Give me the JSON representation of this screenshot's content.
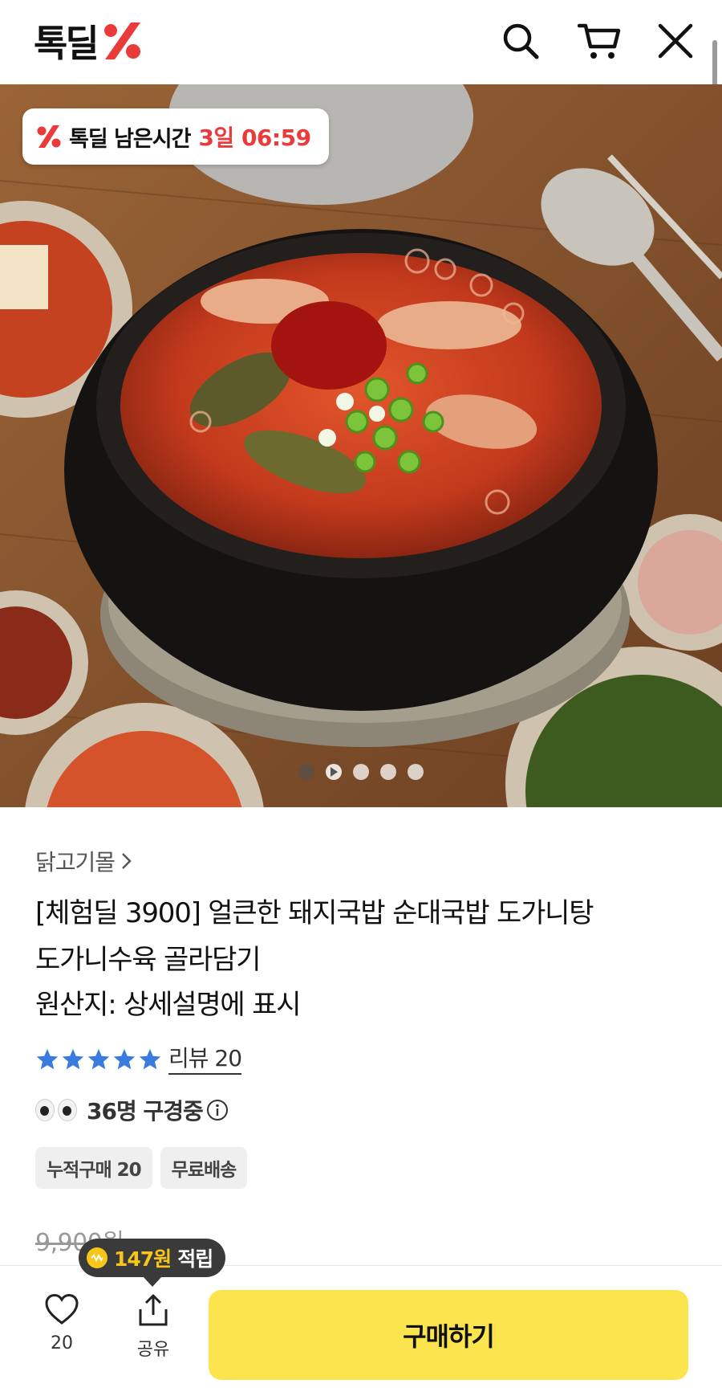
{
  "header": {
    "logo_text": "톡딜",
    "icons": [
      "search-icon",
      "cart-icon",
      "close-icon"
    ]
  },
  "hero": {
    "timer_label": "톡딜 남은시간",
    "timer_value": "3일 06:59",
    "slide_count": 5,
    "active_slide": 1
  },
  "product": {
    "seller": "닭고기몰",
    "title_line1": "[체험딜 3900] 얼큰한 돼지국밥 순대국밥 도가니탕",
    "title_line2": "도가니수육 골라담기",
    "origin": "원산지: 상세설명에 표시",
    "rating_stars": 5,
    "review_label": "리뷰 20",
    "viewers": "36명 구경중",
    "chips": [
      "누적구매 20",
      "무료배송"
    ],
    "original_price": "9,900원"
  },
  "bottom_bar": {
    "points_amount": "147원",
    "points_label": "적립",
    "like_count": "20",
    "share_label": "공유",
    "buy_label": "구매하기"
  },
  "colors": {
    "accent_red": "#ea3a3a",
    "buy_yellow": "#fbe44d",
    "star_blue": "#3a7be0",
    "coin_yellow": "#f7c619"
  }
}
